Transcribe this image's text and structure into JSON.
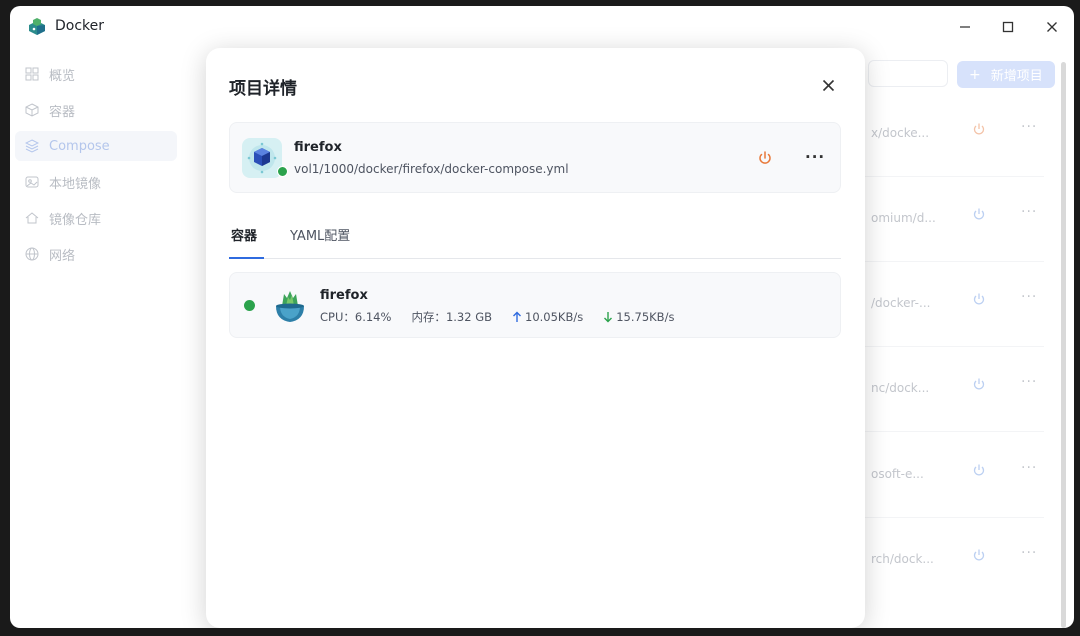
{
  "app": {
    "title": "Docker"
  },
  "window_controls": {
    "minimize": "—",
    "maximize": "☐",
    "close": "✕"
  },
  "sidebar": {
    "items": [
      {
        "label": "概览",
        "icon": "grid-icon"
      },
      {
        "label": "容器",
        "icon": "cube-icon"
      },
      {
        "label": "Compose",
        "icon": "layers-icon",
        "active": true
      },
      {
        "label": "本地镜像",
        "icon": "image-icon"
      },
      {
        "label": "镜像仓库",
        "icon": "home-icon"
      },
      {
        "label": "网络",
        "icon": "globe-icon"
      }
    ]
  },
  "background": {
    "new_button": "新增项目",
    "rows": [
      {
        "path": "x/docke..."
      },
      {
        "path": "omium/d..."
      },
      {
        "path": "/docker-..."
      },
      {
        "path": "nc/dock..."
      },
      {
        "path": "osoft-e..."
      },
      {
        "path": "rch/dock..."
      }
    ]
  },
  "modal": {
    "title": "项目详情",
    "close_label": "✕",
    "project": {
      "name": "firefox",
      "path": "vol1/1000/docker/firefox/docker-compose.yml",
      "status": "running",
      "more_label": "···"
    },
    "tabs": [
      {
        "label": "容器",
        "active": true
      },
      {
        "label": "YAML配置",
        "active": false
      }
    ],
    "containers": [
      {
        "name": "firefox",
        "cpu_label": "CPU：",
        "cpu": "6.14%",
        "mem_label": "内存：",
        "mem": "1.32 GB",
        "up": "10.05KB/s",
        "down": "15.75KB/s"
      }
    ]
  },
  "colors": {
    "accent": "#2f6bdf",
    "status_green": "#2ba24c",
    "power_orange": "#e8793a",
    "up_arrow": "#2f6bdf",
    "down_arrow": "#2ba24c"
  }
}
